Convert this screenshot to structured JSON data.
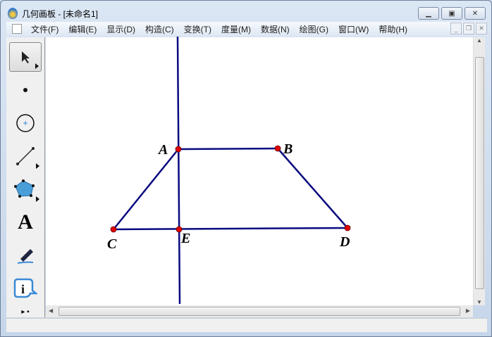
{
  "window": {
    "title": "几何画板 - [未命名1]"
  },
  "menu": [
    "文件(F)",
    "编辑(E)",
    "显示(D)",
    "构造(C)",
    "变换(T)",
    "度量(M)",
    "数据(N)",
    "绘图(G)",
    "窗口(W)",
    "帮助(H)"
  ],
  "tools": [
    "arrow-select",
    "point",
    "compass",
    "straightedge",
    "polygon",
    "text",
    "marker",
    "information",
    "custom"
  ],
  "points": {
    "A": "A",
    "B": "B",
    "C": "C",
    "D": "D",
    "E": "E"
  },
  "colors": {
    "line": "#0a0a80",
    "point": "#e00000"
  }
}
